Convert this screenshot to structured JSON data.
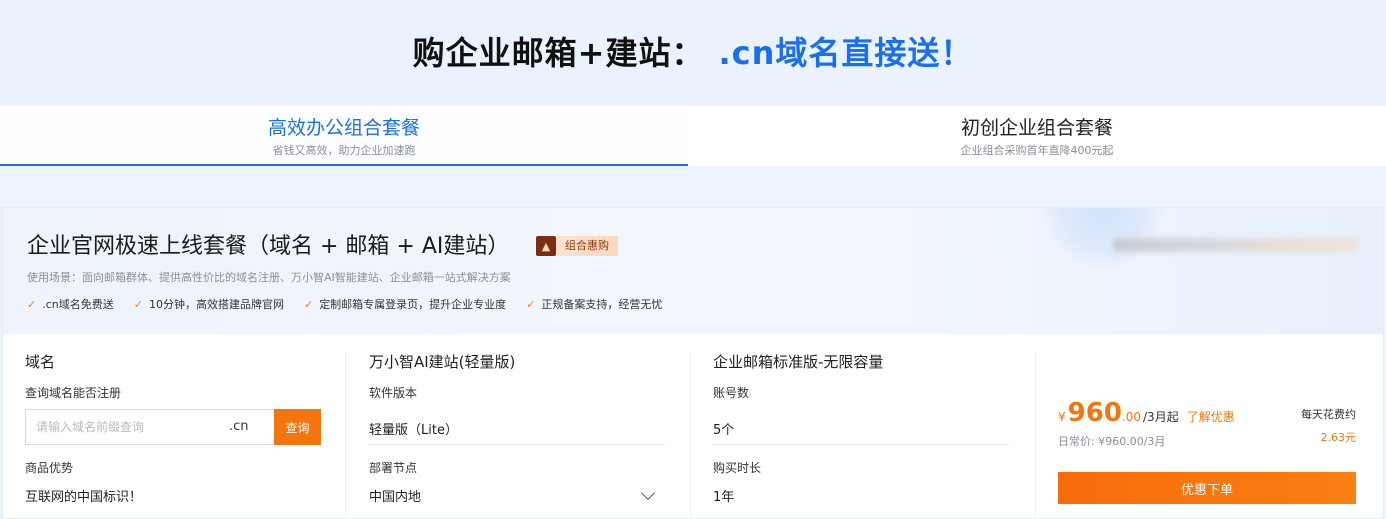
{
  "headline": {
    "main": "购企业邮箱+建站：",
    "accent": ".cn域名直接送！"
  },
  "tabs": [
    {
      "title": "高效办公组合套餐",
      "subtitle": "省钱又高效，助力企业加速跑"
    },
    {
      "title": "初创企业组合套餐",
      "subtitle": "企业组合采购首年直降400元起"
    }
  ],
  "package": {
    "title": "企业官网极速上线套餐（域名 + 邮箱 + AI建站）",
    "badge_icon": "fire-icon",
    "badge": "组合惠购",
    "scenario": "使用场景：面向邮箱群体、提供高性价比的域名注册、万小智AI智能建站、企业邮箱一站式解决方案",
    "features": [
      ".cn域名免费送",
      "10分钟，高效搭建品牌官网",
      "定制邮箱专属登录页，提升企业专业度",
      "正规备案支持，经营无忧"
    ]
  },
  "domain_col": {
    "title": "域名",
    "query_label": "查询域名能否注册",
    "placeholder": "请输入域名前缀查询",
    "suffix": ".cn",
    "search_button": "查询",
    "advantage_label": "商品优势",
    "advantage_value": "互联网的中国标识！"
  },
  "site_col": {
    "title": "万小智AI建站(轻量版)",
    "version_label": "软件版本",
    "version_value": "轻量版（Lite）",
    "node_label": "部署节点",
    "node_value": "中国内地"
  },
  "mail_col": {
    "title": "企业邮箱标准版-无限容量",
    "accounts_label": "账号数",
    "accounts_value": "5个",
    "duration_label": "购买时长",
    "duration_value": "1年"
  },
  "price": {
    "currency": "¥",
    "integer": "960",
    "decimal": ".00",
    "unit": "/3月起",
    "learn_more": "了解优惠",
    "original": "日常价: ¥960.00/3月",
    "daily_label": "每天花费约",
    "daily_value": "2.63元",
    "order_button": "优惠下单"
  },
  "colors": {
    "accent_blue": "#1a6ef0",
    "accent_orange": "#f5750d"
  }
}
